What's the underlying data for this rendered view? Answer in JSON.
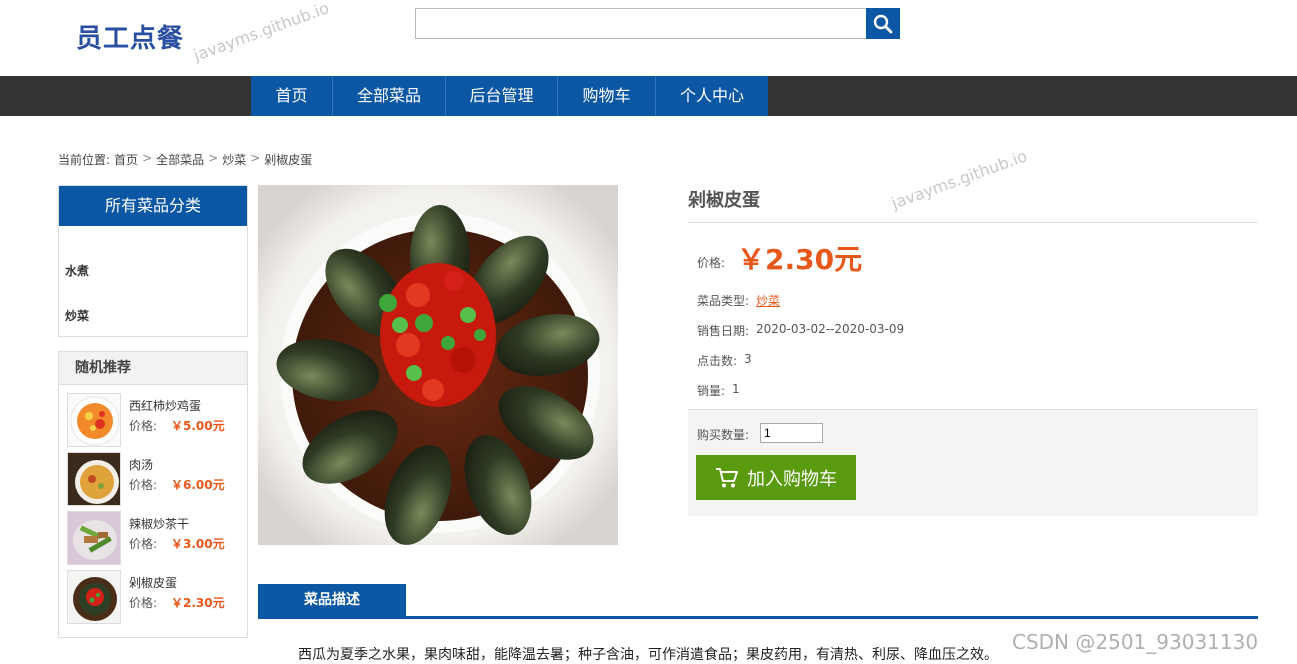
{
  "header": {
    "logo": "员工点餐",
    "search_placeholder": ""
  },
  "watermark": "javayms.github.io",
  "nav": {
    "items": [
      "首页",
      "全部菜品",
      "后台管理",
      "购物车",
      "个人中心"
    ]
  },
  "breadcrumb": {
    "prefix": "当前位置:",
    "items": [
      "首页",
      "全部菜品",
      "炒菜",
      "剁椒皮蛋"
    ],
    "separator": ">"
  },
  "sidebar": {
    "categories_title": "所有菜品分类",
    "categories": [
      "水煮",
      "炒菜"
    ],
    "recommend_title": "随机推荐",
    "recommend": [
      {
        "name": "西红柿炒鸡蛋",
        "price_label": "价格:",
        "price": "￥5.00元"
      },
      {
        "name": "肉汤",
        "price_label": "价格:",
        "price": "￥6.00元"
      },
      {
        "name": "辣椒炒茶干",
        "price_label": "价格:",
        "price": "￥3.00元"
      },
      {
        "name": "剁椒皮蛋",
        "price_label": "价格:",
        "price": "￥2.30元"
      }
    ]
  },
  "product": {
    "title": "剁椒皮蛋",
    "price_label": "价格:",
    "price": "￥2.30元",
    "type_label": "菜品类型:",
    "type_value": "炒菜",
    "date_label": "销售日期:",
    "date_value": "2020-03-02--2020-03-09",
    "clicks_label": "点击数:",
    "clicks_value": "3",
    "sales_label": "销量:",
    "sales_value": "1",
    "qty_label": "购买数量:",
    "qty_value": "1",
    "cart_button": "加入购物车"
  },
  "description": {
    "tab_label": "菜品描述",
    "text": "西瓜为夏季之水果，果肉味甜，能降温去暑；种子含油，可作消遣食品；果皮药用，有清热、利尿、降血压之效。"
  },
  "csdn_watermark": "CSDN @2501_93031130",
  "colors": {
    "primary_blue": "#0b57a3",
    "nav_dark": "#333333",
    "price_orange": "#e8571a",
    "cart_green": "#5a9a0f"
  }
}
